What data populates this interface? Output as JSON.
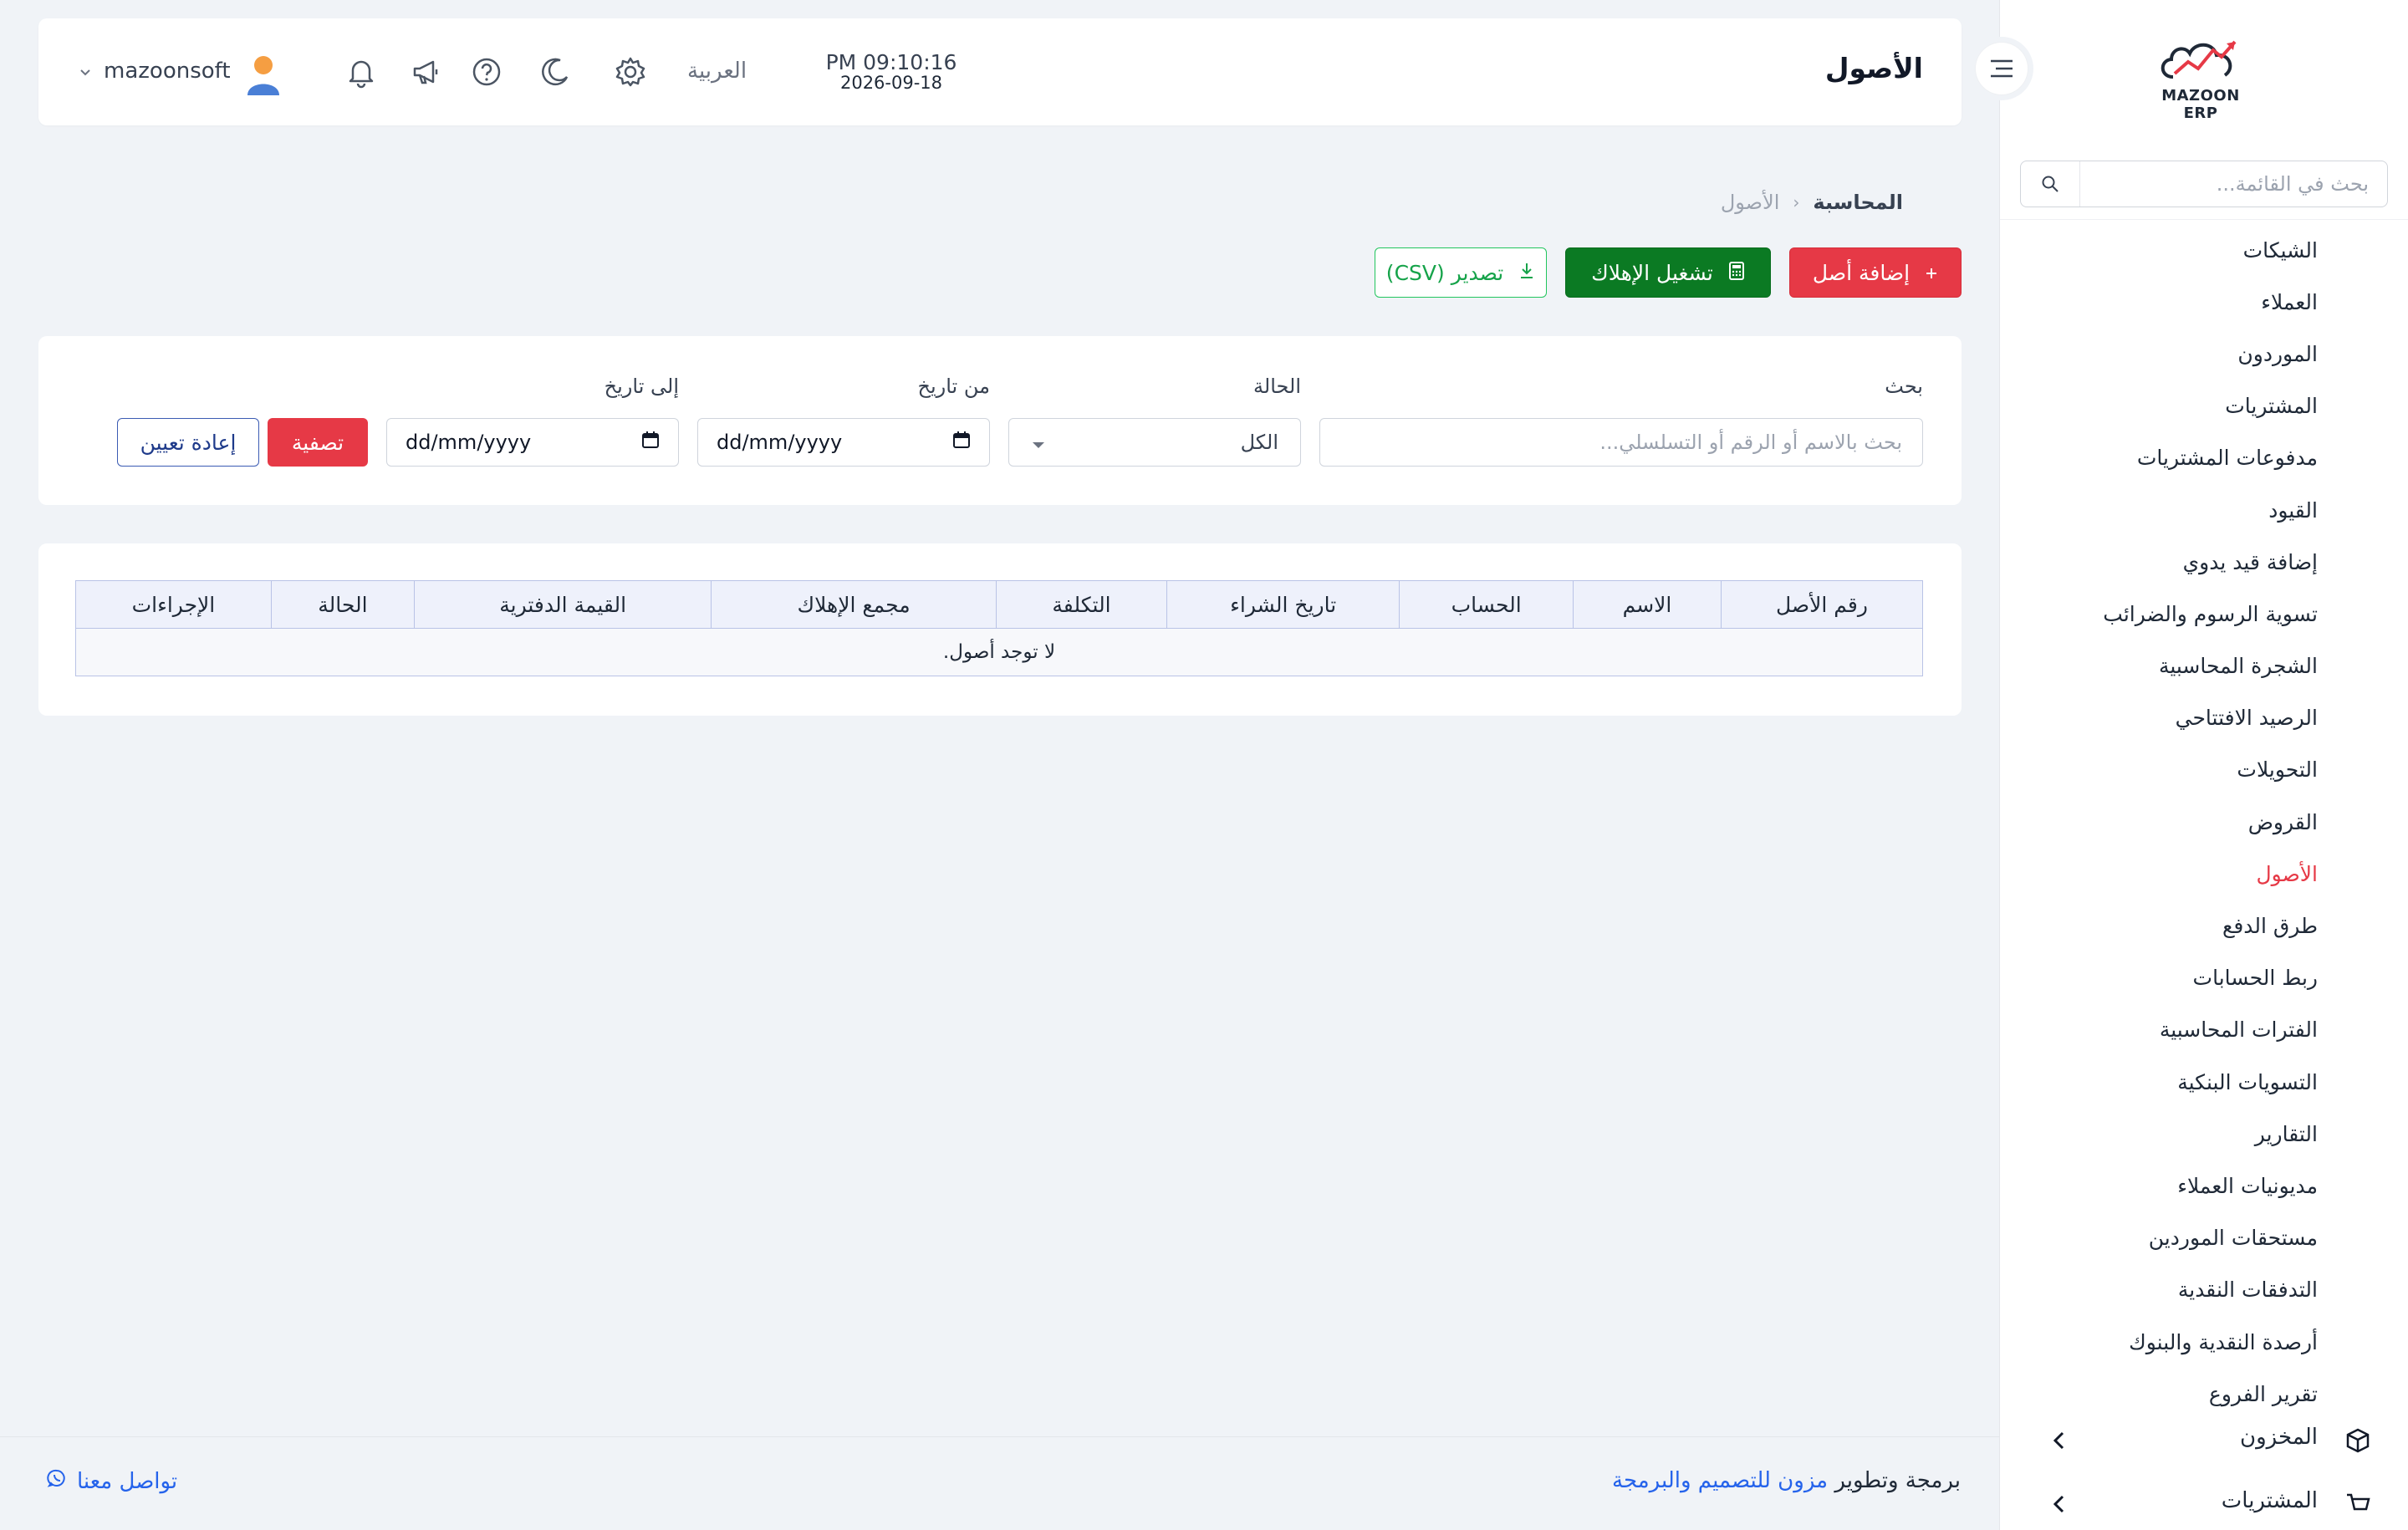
{
  "colors": {
    "accent_red": "#e63946",
    "accent_green": "#0b7a23",
    "csv_green": "#22c55e",
    "link_blue": "#2563eb",
    "background": "#f0f3f7"
  },
  "sidebar": {
    "logo_text": "MAZOON ERP",
    "search_placeholder": "بحث في القائمة...",
    "items": [
      {
        "label": "الشيكات"
      },
      {
        "label": "العملاء"
      },
      {
        "label": "الموردون"
      },
      {
        "label": "المشتريات"
      },
      {
        "label": "مدفوعات المشتريات"
      },
      {
        "label": "القيود"
      },
      {
        "label": "إضافة قيد يدوي"
      },
      {
        "label": "تسوية الرسوم والضرائب"
      },
      {
        "label": "الشجرة المحاسبية"
      },
      {
        "label": "الرصيد الافتتاحي"
      },
      {
        "label": "التحويلات"
      },
      {
        "label": "القروض"
      },
      {
        "label": "الأصول",
        "active": true
      },
      {
        "label": "طرق الدفع"
      },
      {
        "label": "ربط الحسابات"
      },
      {
        "label": "الفترات المحاسبية"
      },
      {
        "label": "التسويات البنكية"
      },
      {
        "label": "التقارير"
      },
      {
        "label": "مديونيات العملاء"
      },
      {
        "label": "مستحقات الموردين"
      },
      {
        "label": "التدفقات النقدية"
      },
      {
        "label": "أرصدة النقدية والبنوك"
      },
      {
        "label": "تقرير الفروع"
      }
    ],
    "group_inventory": {
      "label": "المخزون",
      "icon": "box-icon"
    },
    "group_next": {
      "label": "المشتريات",
      "icon": "cart-icon"
    }
  },
  "header": {
    "title": "الأصول",
    "time": "PM 09:10:16",
    "date": "2026-09-18",
    "language": "العربية",
    "username": "mazoonsoft",
    "icons": [
      "settings-icon",
      "moon-icon",
      "help-icon",
      "megaphone-icon",
      "bell-icon"
    ]
  },
  "breadcrumb": {
    "root": "المحاسبة",
    "separator": "‹",
    "current": "الأصول"
  },
  "actions": {
    "add_asset": "إضافة أصل",
    "run_depreciation": "تشغيل الإهلاك",
    "export_csv": "تصدير (CSV)"
  },
  "filters": {
    "search_label": "بحث",
    "search_placeholder": "بحث بالاسم أو الرقم أو التسلسلي...",
    "status_label": "الحالة",
    "status_value": "الكل",
    "from_label": "من تاريخ",
    "from_placeholder": "dd/mm/yyyy",
    "to_label": "إلى تاريخ",
    "to_placeholder": "dd/mm/yyyy",
    "filter_button": "تصفية",
    "reset_button": "إعادة تعيين"
  },
  "table": {
    "columns": [
      "رقم الأصل",
      "الاسم",
      "الحساب",
      "تاريخ الشراء",
      "التكلفة",
      "مجمع الإهلاك",
      "القيمة الدفترية",
      "الحالة",
      "الإجراءات"
    ],
    "empty_message": "لا توجد أصول."
  },
  "footer": {
    "credit_prefix": "برمجة وتطوير",
    "credit_link": "مزون للتصميم والبرمجة",
    "contact": "تواصل معنا"
  }
}
